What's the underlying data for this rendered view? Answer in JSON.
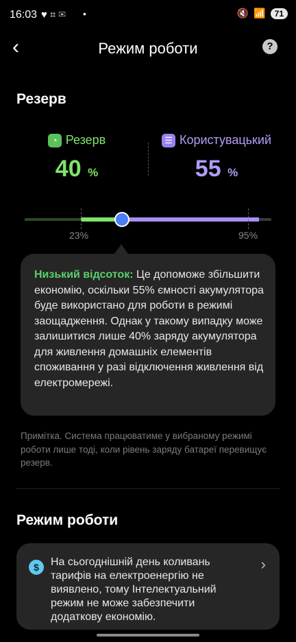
{
  "status_bar": {
    "time": "16:03",
    "battery": "71"
  },
  "header": {
    "title": "Режим роботи",
    "help": "?"
  },
  "reserve": {
    "title": "Резерв",
    "left_label": "Резерв",
    "left_value": "40",
    "right_label": "Користувацький",
    "right_value": "55",
    "unit": "%",
    "slider_reserve_pct": 40,
    "tick_low": "23%",
    "tick_high": "95%"
  },
  "tooltip": {
    "lead": "Низький відсоток:",
    "text": " Це допоможе збільшити економію, оскільки 55% ємності акумулятора буде використано для роботи в режимі заощадження. Однак у такому випадку може залишитися лише 40% заряду акумулятора для живлення домашніх елементів споживання у разі відключення живлення від електромережі."
  },
  "note": "Примітка. Система працюватиме у вибраному режимі роботи лише тоді, коли рівень заряду батареї перевищує резерв.",
  "mode": {
    "title": "Режим роботи",
    "card_text": "На сьогоднішній день коливань тарифів на електроенергію не виявлено, тому Інтелектуальний режим не може забезпечити додаткову економію."
  },
  "colors": {
    "green": "#7fe36a",
    "purple": "#a98ff5",
    "thumb": "#4a7ef7"
  }
}
